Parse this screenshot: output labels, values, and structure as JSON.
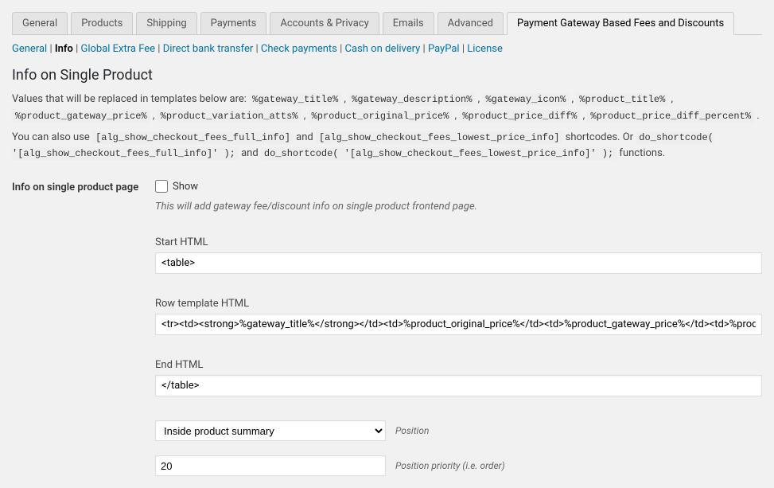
{
  "tabs": {
    "general": "General",
    "products": "Products",
    "shipping": "Shipping",
    "payments": "Payments",
    "accounts": "Accounts & Privacy",
    "emails": "Emails",
    "advanced": "Advanced",
    "pgbf": "Payment Gateway Based Fees and Discounts"
  },
  "subnav": {
    "general": "General",
    "info": "Info",
    "global_extra_fee": "Global Extra Fee",
    "direct_bank": "Direct bank transfer",
    "check": "Check payments",
    "cod": "Cash on delivery",
    "paypal": "PayPal",
    "license": "License"
  },
  "section": {
    "title": "Info on Single Product",
    "values_intro": "Values that will be replaced in templates below are: ",
    "placeholders": [
      "%gateway_title%",
      "%gateway_description%",
      "%gateway_icon%",
      "%product_title%",
      "%product_gateway_price%",
      "%product_variation_atts%",
      "%product_original_price%",
      "%product_price_diff%",
      "%product_price_diff_percent%"
    ],
    "also_use_pre": "You can also use ",
    "shortcode1": "[alg_show_checkout_fees_full_info]",
    "and": " and ",
    "shortcode2": "[alg_show_checkout_fees_lowest_price_info]",
    "also_use_post": " shortcodes. Or ",
    "func1": "do_shortcode( '[alg_show_checkout_fees_full_info]' );",
    "and2": " and ",
    "func2": "do_shortcode( '[alg_show_checkout_fees_lowest_price_info]' );",
    "functions_text": " functions."
  },
  "form": {
    "row_label": "Info on single product page",
    "show_label": "Show",
    "show_help": "This will add gateway fee/discount info on single product frontend page.",
    "start_html_label": "Start HTML",
    "start_html_value": "<table>",
    "row_template_label": "Row template HTML",
    "row_template_value": "<tr><td><strong>%gateway_title%</strong></td><td>%product_original_price%</td><td>%product_gateway_price%</td><td>%product_price_diff%</td></tr>",
    "end_html_label": "End HTML",
    "end_html_value": "</table>",
    "position_label": "Position",
    "position_value": "Inside product summary",
    "priority_label": "Position priority (i.e. order)",
    "priority_value": "20"
  }
}
